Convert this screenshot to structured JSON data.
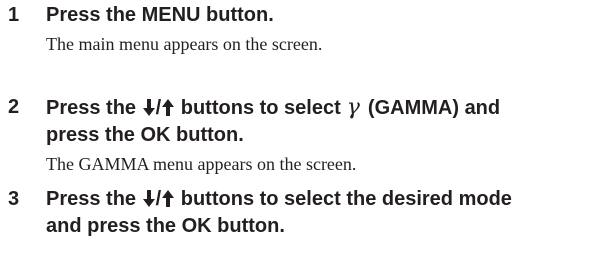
{
  "steps": [
    {
      "number": "1",
      "title": "Press the MENU button.",
      "description": "The main menu appears on the screen."
    },
    {
      "number": "2",
      "title_part1": "Press the",
      "arrow_sep": "/",
      "title_part2": "buttons to select",
      "gamma_symbol": "γ",
      "title_part3": "(GAMMA) and",
      "title_line2": "press the OK button.",
      "description": "The GAMMA menu appears on the screen."
    },
    {
      "number": "3",
      "title_part1": "Press the",
      "arrow_sep": "/",
      "title_part2": "buttons to select the desired mode",
      "title_line2": "and press the OK button."
    }
  ],
  "icons": {
    "down": "down-arrow-icon",
    "up": "up-arrow-icon",
    "gamma": "gamma-icon"
  }
}
